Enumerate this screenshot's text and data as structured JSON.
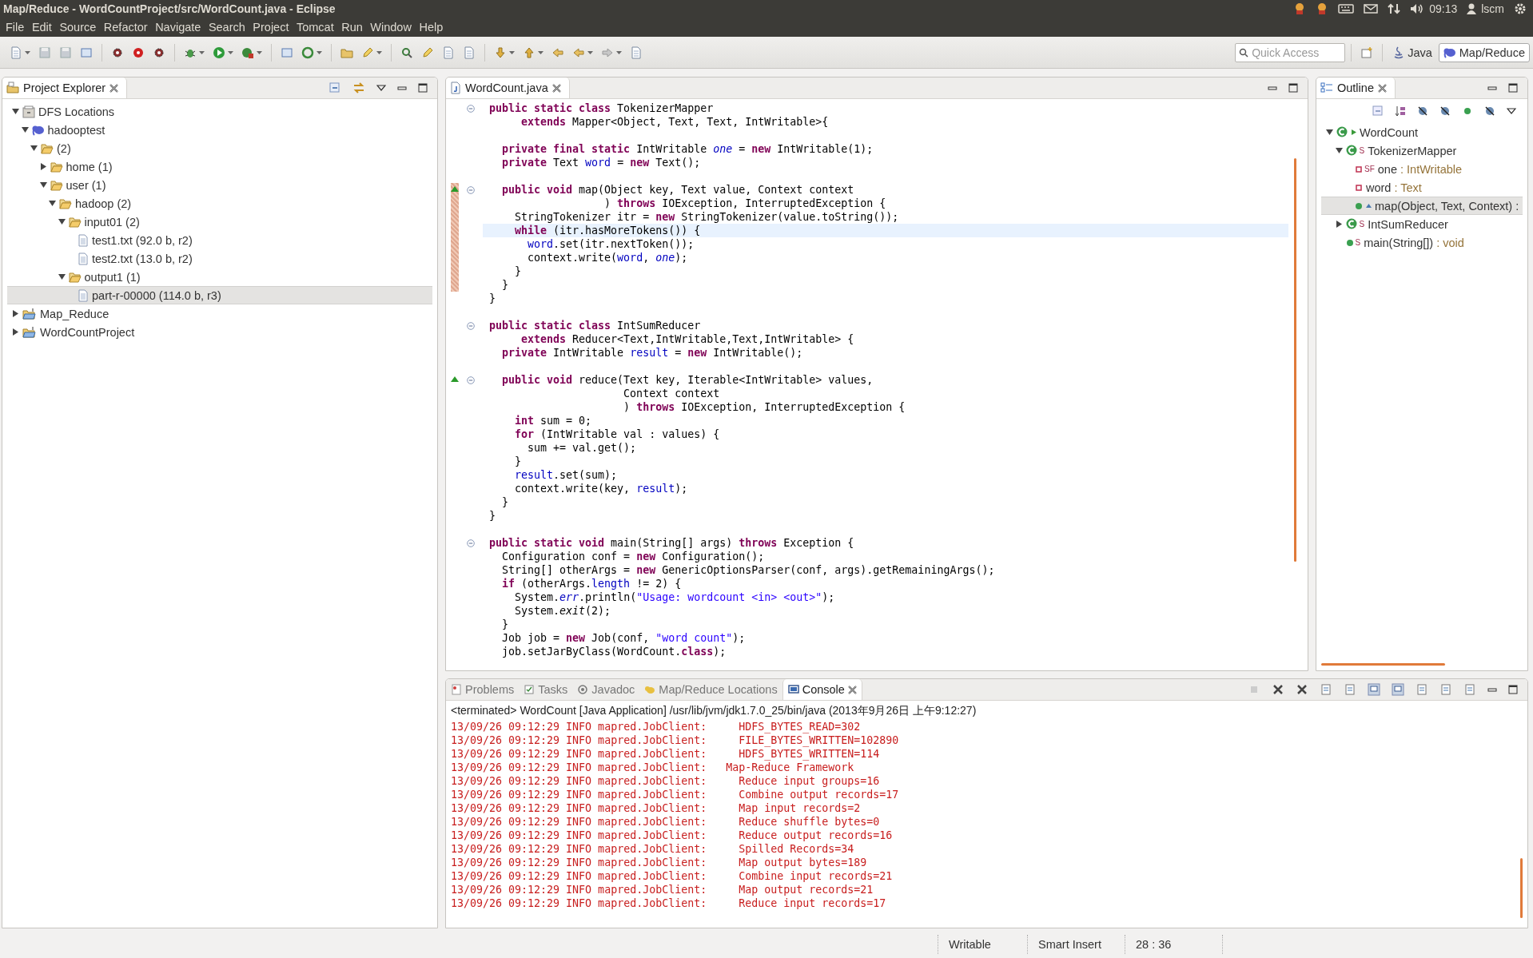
{
  "window": {
    "title": "Map/Reduce - WordCountProject/src/WordCount.java - Eclipse"
  },
  "tray": {
    "clock": "09:13",
    "user": "lscm"
  },
  "menu": [
    "File",
    "Edit",
    "Source",
    "Refactor",
    "Navigate",
    "Search",
    "Project",
    "Tomcat",
    "Run",
    "Window",
    "Help"
  ],
  "toolbar": {
    "quick_access": {
      "placeholder": "Quick Access"
    },
    "perspectives": [
      {
        "label": "Java",
        "selected": false
      },
      {
        "label": "Map/Reduce",
        "selected": true
      }
    ]
  },
  "project_explorer": {
    "title": "Project Explorer",
    "tree": [
      {
        "label": "DFS Locations",
        "kind": "dfs",
        "expanded": true,
        "selected": false,
        "children": [
          {
            "label": "hadooptest",
            "kind": "server",
            "expanded": true,
            "selected": false,
            "children": [
              {
                "label": "(2)",
                "kind": "folder",
                "expanded": true,
                "selected": false,
                "children": [
                  {
                    "label": "home (1)",
                    "kind": "folder",
                    "expanded": false,
                    "selected": false
                  },
                  {
                    "label": "user (1)",
                    "kind": "folder",
                    "expanded": true,
                    "selected": false,
                    "children": [
                      {
                        "label": "hadoop (2)",
                        "kind": "folder",
                        "expanded": true,
                        "selected": false,
                        "children": [
                          {
                            "label": "input01 (2)",
                            "kind": "folder",
                            "expanded": true,
                            "selected": false,
                            "children": [
                              {
                                "label": "test1.txt (92.0 b, r2)",
                                "kind": "file",
                                "selected": false
                              },
                              {
                                "label": "test2.txt (13.0 b, r2)",
                                "kind": "file",
                                "selected": false
                              }
                            ]
                          },
                          {
                            "label": "output1 (1)",
                            "kind": "folder",
                            "expanded": true,
                            "selected": false,
                            "children": [
                              {
                                "label": "part-r-00000 (114.0 b, r3)",
                                "kind": "file",
                                "selected": true
                              }
                            ]
                          }
                        ]
                      }
                    ]
                  }
                ]
              }
            ]
          }
        ]
      },
      {
        "label": "Map_Reduce",
        "kind": "project",
        "expanded": false,
        "selected": false
      },
      {
        "label": "WordCountProject",
        "kind": "project",
        "expanded": false,
        "selected": false
      }
    ]
  },
  "editor": {
    "tab": "WordCount.java",
    "blocks": [
      {
        "lines": [
          {
            "fold": true,
            "override": false,
            "changed": false,
            "current": false,
            "tokens": [
              {
                "text": "public static class ",
                "kind": "kw"
              },
              {
                "text": "TokenizerMapper",
                "kind": "plain"
              }
            ]
          },
          {
            "fold": false,
            "override": false,
            "changed": false,
            "current": false,
            "tokens": [
              {
                "text": "     extends ",
                "kind": "kw"
              },
              {
                "text": "Mapper<Object, Text, Text, IntWritable>{",
                "kind": "plain"
              }
            ]
          }
        ]
      },
      {
        "lines": [
          {
            "fold": false,
            "override": false,
            "changed": false,
            "current": false,
            "tokens": [
              {
                "text": "  private final static ",
                "kind": "kw"
              },
              {
                "text": "IntWritable ",
                "kind": "plain"
              },
              {
                "text": "one",
                "kind": "static"
              },
              {
                "text": " = ",
                "kind": "plain"
              },
              {
                "text": "new ",
                "kind": "kw"
              },
              {
                "text": "IntWritable(1);",
                "kind": "plain"
              }
            ]
          },
          {
            "fold": false,
            "override": false,
            "changed": false,
            "current": false,
            "tokens": [
              {
                "text": "  private ",
                "kind": "kw"
              },
              {
                "text": "Text ",
                "kind": "plain"
              },
              {
                "text": "word",
                "kind": "field"
              },
              {
                "text": " = ",
                "kind": "plain"
              },
              {
                "text": "new ",
                "kind": "kw"
              },
              {
                "text": "Text();",
                "kind": "plain"
              }
            ]
          }
        ]
      },
      {
        "lines": [
          {
            "fold": true,
            "override": true,
            "changed": true,
            "current": false,
            "tokens": [
              {
                "text": "  public void ",
                "kind": "kw"
              },
              {
                "text": "map(Object key, Text value, Context context",
                "kind": "plain"
              }
            ]
          },
          {
            "fold": false,
            "override": false,
            "changed": true,
            "current": false,
            "tokens": [
              {
                "text": "                  ) ",
                "kind": "plain"
              },
              {
                "text": "throws ",
                "kind": "kw"
              },
              {
                "text": "IOException, InterruptedException {",
                "kind": "plain"
              }
            ]
          },
          {
            "fold": false,
            "override": false,
            "changed": true,
            "current": false,
            "tokens": [
              {
                "text": "    StringTokenizer itr = ",
                "kind": "plain"
              },
              {
                "text": "new ",
                "kind": "kw"
              },
              {
                "text": "StringTokenizer(value.toString());",
                "kind": "plain"
              }
            ]
          },
          {
            "fold": false,
            "override": false,
            "changed": true,
            "current": true,
            "tokens": [
              {
                "text": "    while ",
                "kind": "kw"
              },
              {
                "text": "(itr.hasMoreTokens()) {",
                "kind": "plain"
              }
            ]
          },
          {
            "fold": false,
            "override": false,
            "changed": true,
            "current": false,
            "tokens": [
              {
                "text": "      word",
                "kind": "field"
              },
              {
                "text": ".set(itr.nextToken());",
                "kind": "plain"
              }
            ]
          },
          {
            "fold": false,
            "override": false,
            "changed": true,
            "current": false,
            "tokens": [
              {
                "text": "      context.write(",
                "kind": "plain"
              },
              {
                "text": "word",
                "kind": "field"
              },
              {
                "text": ", ",
                "kind": "plain"
              },
              {
                "text": "one",
                "kind": "static"
              },
              {
                "text": ");",
                "kind": "plain"
              }
            ]
          },
          {
            "fold": false,
            "override": false,
            "changed": true,
            "current": false,
            "tokens": [
              {
                "text": "    }",
                "kind": "plain"
              }
            ]
          },
          {
            "fold": false,
            "override": false,
            "changed": true,
            "current": false,
            "tokens": [
              {
                "text": "  }",
                "kind": "plain"
              }
            ]
          },
          {
            "fold": false,
            "override": false,
            "changed": false,
            "current": false,
            "tokens": [
              {
                "text": "}",
                "kind": "plain"
              }
            ]
          }
        ]
      },
      {
        "lines": [
          {
            "fold": true,
            "override": false,
            "changed": false,
            "current": false,
            "tokens": [
              {
                "text": "public static class ",
                "kind": "kw"
              },
              {
                "text": "IntSumReducer",
                "kind": "plain"
              }
            ]
          },
          {
            "fold": false,
            "override": false,
            "changed": false,
            "current": false,
            "tokens": [
              {
                "text": "     extends ",
                "kind": "kw"
              },
              {
                "text": "Reducer<Text,IntWritable,Text,IntWritable> {",
                "kind": "plain"
              }
            ]
          },
          {
            "fold": false,
            "override": false,
            "changed": false,
            "current": false,
            "tokens": [
              {
                "text": "  private ",
                "kind": "kw"
              },
              {
                "text": "IntWritable ",
                "kind": "plain"
              },
              {
                "text": "result",
                "kind": "field"
              },
              {
                "text": " = ",
                "kind": "plain"
              },
              {
                "text": "new ",
                "kind": "kw"
              },
              {
                "text": "IntWritable();",
                "kind": "plain"
              }
            ]
          }
        ]
      },
      {
        "lines": [
          {
            "fold": true,
            "override": true,
            "changed": false,
            "current": false,
            "tokens": [
              {
                "text": "  public void ",
                "kind": "kw"
              },
              {
                "text": "reduce(Text key, Iterable<IntWritable> values,",
                "kind": "plain"
              }
            ]
          },
          {
            "fold": false,
            "override": false,
            "changed": false,
            "current": false,
            "tokens": [
              {
                "text": "                     Context context",
                "kind": "plain"
              }
            ]
          },
          {
            "fold": false,
            "override": false,
            "changed": false,
            "current": false,
            "tokens": [
              {
                "text": "                     ) ",
                "kind": "plain"
              },
              {
                "text": "throws ",
                "kind": "kw"
              },
              {
                "text": "IOException, InterruptedException {",
                "kind": "plain"
              }
            ]
          },
          {
            "fold": false,
            "override": false,
            "changed": false,
            "current": false,
            "tokens": [
              {
                "text": "    int ",
                "kind": "kw"
              },
              {
                "text": "sum = 0;",
                "kind": "plain"
              }
            ]
          },
          {
            "fold": false,
            "override": false,
            "changed": false,
            "current": false,
            "tokens": [
              {
                "text": "    for ",
                "kind": "kw"
              },
              {
                "text": "(IntWritable val : values) {",
                "kind": "plain"
              }
            ]
          },
          {
            "fold": false,
            "override": false,
            "changed": false,
            "current": false,
            "tokens": [
              {
                "text": "      sum += val.get();",
                "kind": "plain"
              }
            ]
          },
          {
            "fold": false,
            "override": false,
            "changed": false,
            "current": false,
            "tokens": [
              {
                "text": "    }",
                "kind": "plain"
              }
            ]
          },
          {
            "fold": false,
            "override": false,
            "changed": false,
            "current": false,
            "tokens": [
              {
                "text": "    result",
                "kind": "field"
              },
              {
                "text": ".set(sum);",
                "kind": "plain"
              }
            ]
          },
          {
            "fold": false,
            "override": false,
            "changed": false,
            "current": false,
            "tokens": [
              {
                "text": "    context.write(key, ",
                "kind": "plain"
              },
              {
                "text": "result",
                "kind": "field"
              },
              {
                "text": ");",
                "kind": "plain"
              }
            ]
          },
          {
            "fold": false,
            "override": false,
            "changed": false,
            "current": false,
            "tokens": [
              {
                "text": "  }",
                "kind": "plain"
              }
            ]
          },
          {
            "fold": false,
            "override": false,
            "changed": false,
            "current": false,
            "tokens": [
              {
                "text": "}",
                "kind": "plain"
              }
            ]
          }
        ]
      },
      {
        "lines": [
          {
            "fold": true,
            "override": false,
            "changed": false,
            "current": false,
            "tokens": [
              {
                "text": "public static void ",
                "kind": "kw"
              },
              {
                "text": "main(String[] args) ",
                "kind": "plain"
              },
              {
                "text": "throws ",
                "kind": "kw"
              },
              {
                "text": "Exception {",
                "kind": "plain"
              }
            ]
          },
          {
            "fold": false,
            "override": false,
            "changed": false,
            "current": false,
            "tokens": [
              {
                "text": "  Configuration conf = ",
                "kind": "plain"
              },
              {
                "text": "new ",
                "kind": "kw"
              },
              {
                "text": "Configuration();",
                "kind": "plain"
              }
            ]
          },
          {
            "fold": false,
            "override": false,
            "changed": false,
            "current": false,
            "tokens": [
              {
                "text": "  String[] otherArgs = ",
                "kind": "plain"
              },
              {
                "text": "new ",
                "kind": "kw"
              },
              {
                "text": "GenericOptionsParser(conf, args).getRemainingArgs();",
                "kind": "plain"
              }
            ]
          },
          {
            "fold": false,
            "override": false,
            "changed": false,
            "current": false,
            "tokens": [
              {
                "text": "  if ",
                "kind": "kw"
              },
              {
                "text": "(otherArgs.",
                "kind": "plain"
              },
              {
                "text": "length",
                "kind": "field"
              },
              {
                "text": " != 2) {",
                "kind": "plain"
              }
            ]
          },
          {
            "fold": false,
            "override": false,
            "changed": false,
            "current": false,
            "tokens": [
              {
                "text": "    System.",
                "kind": "plain"
              },
              {
                "text": "err",
                "kind": "static"
              },
              {
                "text": ".println(",
                "kind": "plain"
              },
              {
                "text": "\"Usage: wordcount <in> <out>\"",
                "kind": "string"
              },
              {
                "text": ");",
                "kind": "plain"
              }
            ]
          },
          {
            "fold": false,
            "override": false,
            "changed": false,
            "current": false,
            "tokens": [
              {
                "text": "    System.",
                "kind": "plain"
              },
              {
                "text": "exit",
                "kind": "italic"
              },
              {
                "text": "(2);",
                "kind": "plain"
              }
            ]
          },
          {
            "fold": false,
            "override": false,
            "changed": false,
            "current": false,
            "tokens": [
              {
                "text": "  }",
                "kind": "plain"
              }
            ]
          },
          {
            "fold": false,
            "override": false,
            "changed": false,
            "current": false,
            "tokens": [
              {
                "text": "  Job job = ",
                "kind": "plain"
              },
              {
                "text": "new ",
                "kind": "kw"
              },
              {
                "text": "Job(conf, ",
                "kind": "plain"
              },
              {
                "text": "\"word count\"",
                "kind": "string"
              },
              {
                "text": ");",
                "kind": "plain"
              }
            ]
          },
          {
            "fold": false,
            "override": false,
            "changed": false,
            "current": false,
            "tokens": [
              {
                "text": "  job.setJarByClass(WordCount.",
                "kind": "plain"
              },
              {
                "text": "class",
                "kind": "kw"
              },
              {
                "text": ");",
                "kind": "plain"
              }
            ]
          }
        ]
      }
    ]
  },
  "outline": {
    "title": "Outline",
    "tree": [
      {
        "name": "WordCount",
        "kind": "class",
        "runnable": true,
        "overrides": false,
        "expanded": true,
        "selected": false,
        "children": [
          {
            "name": "TokenizerMapper",
            "kind": "class",
            "runnable": false,
            "overrides": false,
            "modifiers": "S",
            "expanded": true,
            "selected": false,
            "children": [
              {
                "name": "one",
                "type": ": IntWritable",
                "kind": "field",
                "runnable": false,
                "overrides": false,
                "modifiers": "SF",
                "selected": false
              },
              {
                "name": "word",
                "type": ": Text",
                "kind": "field",
                "runnable": false,
                "overrides": false,
                "selected": false
              },
              {
                "name": "map(Object, Text, Context) :",
                "kind": "method",
                "runnable": false,
                "overrides": true,
                "selected": true
              }
            ]
          },
          {
            "name": "IntSumReducer",
            "kind": "class",
            "runnable": false,
            "overrides": false,
            "modifiers": "S",
            "expanded": false,
            "selected": false
          },
          {
            "name": "main(String[])",
            "type": ": void",
            "kind": "method",
            "runnable": false,
            "overrides": false,
            "modifiers": "S",
            "selected": false
          }
        ]
      }
    ]
  },
  "bottom_panel": {
    "tabs": [
      {
        "label": "Problems",
        "selected": false
      },
      {
        "label": "Tasks",
        "selected": false
      },
      {
        "label": "Javadoc",
        "selected": false
      },
      {
        "label": "Map/Reduce Locations",
        "selected": false
      },
      {
        "label": "Console",
        "selected": true
      }
    ],
    "console": {
      "header": "<terminated> WordCount [Java Application] /usr/lib/jvm/jdk1.7.0_25/bin/java (2013年9月26日 上午9:12:27)",
      "lines": [
        "13/09/26 09:12:29 INFO mapred.JobClient:     HDFS_BYTES_READ=302",
        "13/09/26 09:12:29 INFO mapred.JobClient:     FILE_BYTES_WRITTEN=102890",
        "13/09/26 09:12:29 INFO mapred.JobClient:     HDFS_BYTES_WRITTEN=114",
        "13/09/26 09:12:29 INFO mapred.JobClient:   Map-Reduce Framework",
        "13/09/26 09:12:29 INFO mapred.JobClient:     Reduce input groups=16",
        "13/09/26 09:12:29 INFO mapred.JobClient:     Combine output records=17",
        "13/09/26 09:12:29 INFO mapred.JobClient:     Map input records=2",
        "13/09/26 09:12:29 INFO mapred.JobClient:     Reduce shuffle bytes=0",
        "13/09/26 09:12:29 INFO mapred.JobClient:     Reduce output records=16",
        "13/09/26 09:12:29 INFO mapred.JobClient:     Spilled Records=34",
        "13/09/26 09:12:29 INFO mapred.JobClient:     Map output bytes=189",
        "13/09/26 09:12:29 INFO mapred.JobClient:     Combine input records=21",
        "13/09/26 09:12:29 INFO mapred.JobClient:     Map output records=21",
        "13/09/26 09:12:29 INFO mapred.JobClient:     Reduce input records=17"
      ]
    }
  },
  "status_bar": {
    "mode": "Writable",
    "insert_mode": "Smart Insert",
    "position": "28 : 36"
  }
}
